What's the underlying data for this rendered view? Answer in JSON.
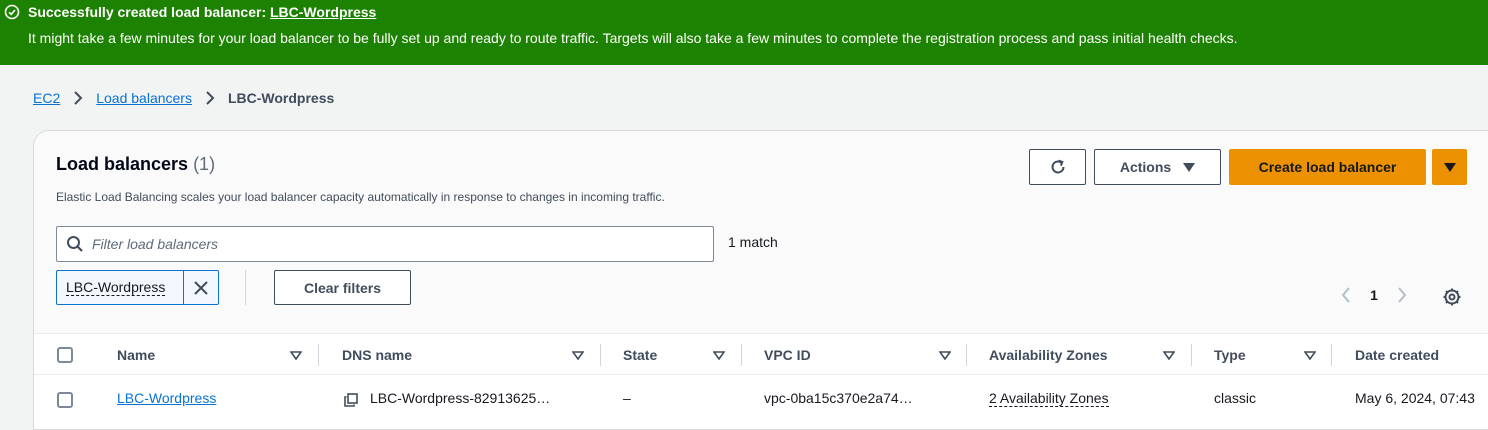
{
  "banner": {
    "title_prefix": "Successfully created load balancer:",
    "title_link": "LBC-Wordpress",
    "message": "It might take a few minutes for your load balancer to be fully set up and ready to route traffic. Targets will also take a few minutes to complete the registration process and pass initial health checks.",
    "color": "#1d8102"
  },
  "breadcrumb": {
    "items": [
      "EC2",
      "Load balancers"
    ],
    "current": "LBC-Wordpress"
  },
  "header": {
    "title": "Load balancers",
    "count": "(1)",
    "description": "Elastic Load Balancing scales your load balancer capacity automatically in response to changes in incoming traffic.",
    "actions_label": "Actions",
    "create_label": "Create load balancer",
    "primary_color": "#ec9100"
  },
  "filter": {
    "placeholder": "Filter load balancers",
    "match_text": "1 match",
    "token": "LBC-Wordpress",
    "clear_label": "Clear filters"
  },
  "pagination": {
    "current_page": "1"
  },
  "table": {
    "columns": [
      "Name",
      "DNS name",
      "State",
      "VPC ID",
      "Availability Zones",
      "Type",
      "Date created"
    ],
    "rows": [
      {
        "name": "LBC-Wordpress",
        "dns": "LBC-Wordpress-82913625…",
        "state": "–",
        "vpc": "vpc-0ba15c370e2a74…",
        "zones": "2 Availability Zones",
        "type": "classic",
        "date": "May 6, 2024, 07:43"
      }
    ]
  },
  "icons": {
    "success": "check-circle-icon",
    "breadcrumb_separator": "chevron-right-icon",
    "refresh": "refresh-icon",
    "dropdown": "caret-down-icon",
    "search": "search-icon",
    "dismiss": "close-icon",
    "prev": "chevron-left-icon",
    "next": "chevron-right-icon",
    "settings": "gear-icon",
    "copy": "copy-icon",
    "sort": "sort-caret-icon"
  }
}
